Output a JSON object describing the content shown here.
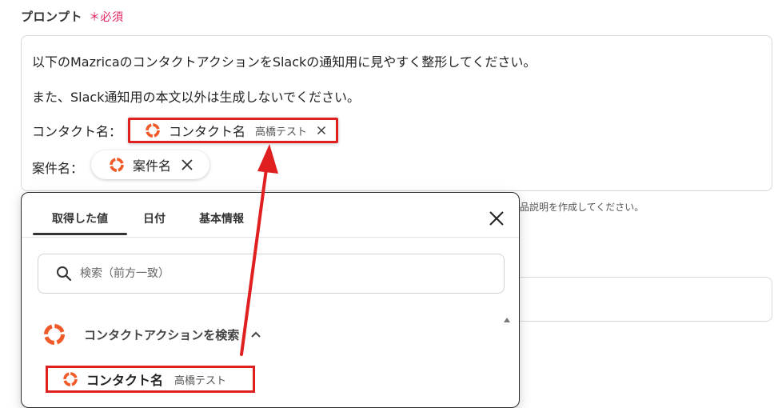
{
  "field": {
    "label": "プロンプト",
    "required_mark": "＊必須"
  },
  "prompt": {
    "line1": "以下のMazricaのコンタクトアクションをSlackの通知用に見やすく整形してください。",
    "line2": "また、Slack通知用の本文以外は生成しないでください。",
    "contact_label": "コンタクト名：",
    "contact_pill": {
      "name": "コンタクト名",
      "sub": "高橋テスト"
    },
    "case_label": "案件名：",
    "case_pill": {
      "name": "案件名"
    }
  },
  "helper_text": "品説明を作成してください。",
  "popup": {
    "tabs": [
      "取得した値",
      "日付",
      "基本情報"
    ],
    "active_tab": "取得した値",
    "search_placeholder": "検索（前方一致）",
    "section_label": "コンタクトアクションを検索",
    "item": {
      "name": "コンタクト名",
      "sub": "高橋テスト"
    }
  },
  "colors": {
    "accent_red": "#e02020",
    "required_pink": "#e0245e",
    "logo_orange": "#f05a28"
  },
  "icons": [
    "mazrica-logo-icon",
    "close-icon",
    "search-icon",
    "chevron-up-icon",
    "scroll-up-icon"
  ]
}
